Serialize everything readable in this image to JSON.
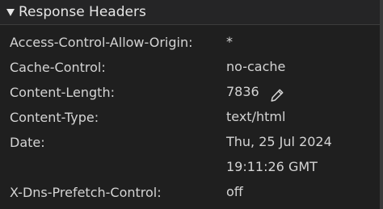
{
  "section": {
    "title": "Response Headers",
    "expanded": true,
    "toggle_icon": "triangle-down-icon"
  },
  "headers": [
    {
      "name": "Access-Control-Allow-Origin:",
      "value_lines": [
        "*"
      ]
    },
    {
      "name": "Cache-Control:",
      "value_lines": [
        "no-cache"
      ]
    },
    {
      "name": "Content-Length:",
      "value_lines": [
        "7836"
      ],
      "edit_icon": "pencil-icon"
    },
    {
      "name": "Content-Type:",
      "value_lines": [
        "text/html"
      ]
    },
    {
      "name": "Date:",
      "value_lines": [
        "Thu, 25 Jul 2024",
        "19:11:26 GMT"
      ]
    },
    {
      "name": "X-Dns-Prefetch-Control:",
      "value_lines": [
        "off"
      ]
    }
  ],
  "colors": {
    "background": "#1f1f1f",
    "header_background": "#252526",
    "text": "#d4d4d4",
    "title_text": "#e6e6e6"
  }
}
